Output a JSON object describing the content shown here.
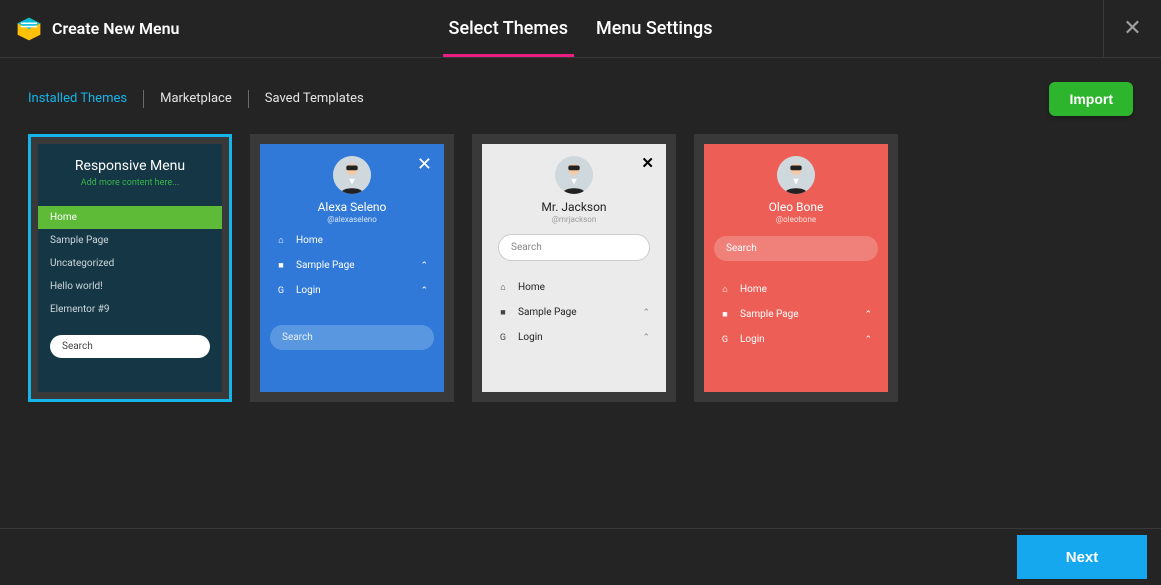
{
  "header": {
    "title": "Create New Menu",
    "tabs": [
      "Select Themes",
      "Menu Settings"
    ]
  },
  "subnav": {
    "items": [
      "Installed Themes",
      "Marketplace",
      "Saved Templates"
    ],
    "import_label": "Import"
  },
  "themes": [
    {
      "title": "Responsive Menu",
      "subtitle": "Add more content here...",
      "items": [
        "Home",
        "Sample Page",
        "Uncategorized",
        "Hello world!",
        "Elementor #9"
      ],
      "search_label": "Search"
    },
    {
      "username": "Alexa Seleno",
      "handle": "@alexaseleno",
      "items": [
        "Home",
        "Sample Page",
        "Login"
      ],
      "search_label": "Search"
    },
    {
      "username": "Mr. Jackson",
      "handle": "@mrjackson",
      "items": [
        "Home",
        "Sample Page",
        "Login"
      ],
      "search_label": "Search"
    },
    {
      "username": "Oleo Bone",
      "handle": "@oleobone",
      "items": [
        "Home",
        "Sample Page",
        "Login"
      ],
      "search_label": "Search"
    }
  ],
  "footer": {
    "next_label": "Next"
  }
}
